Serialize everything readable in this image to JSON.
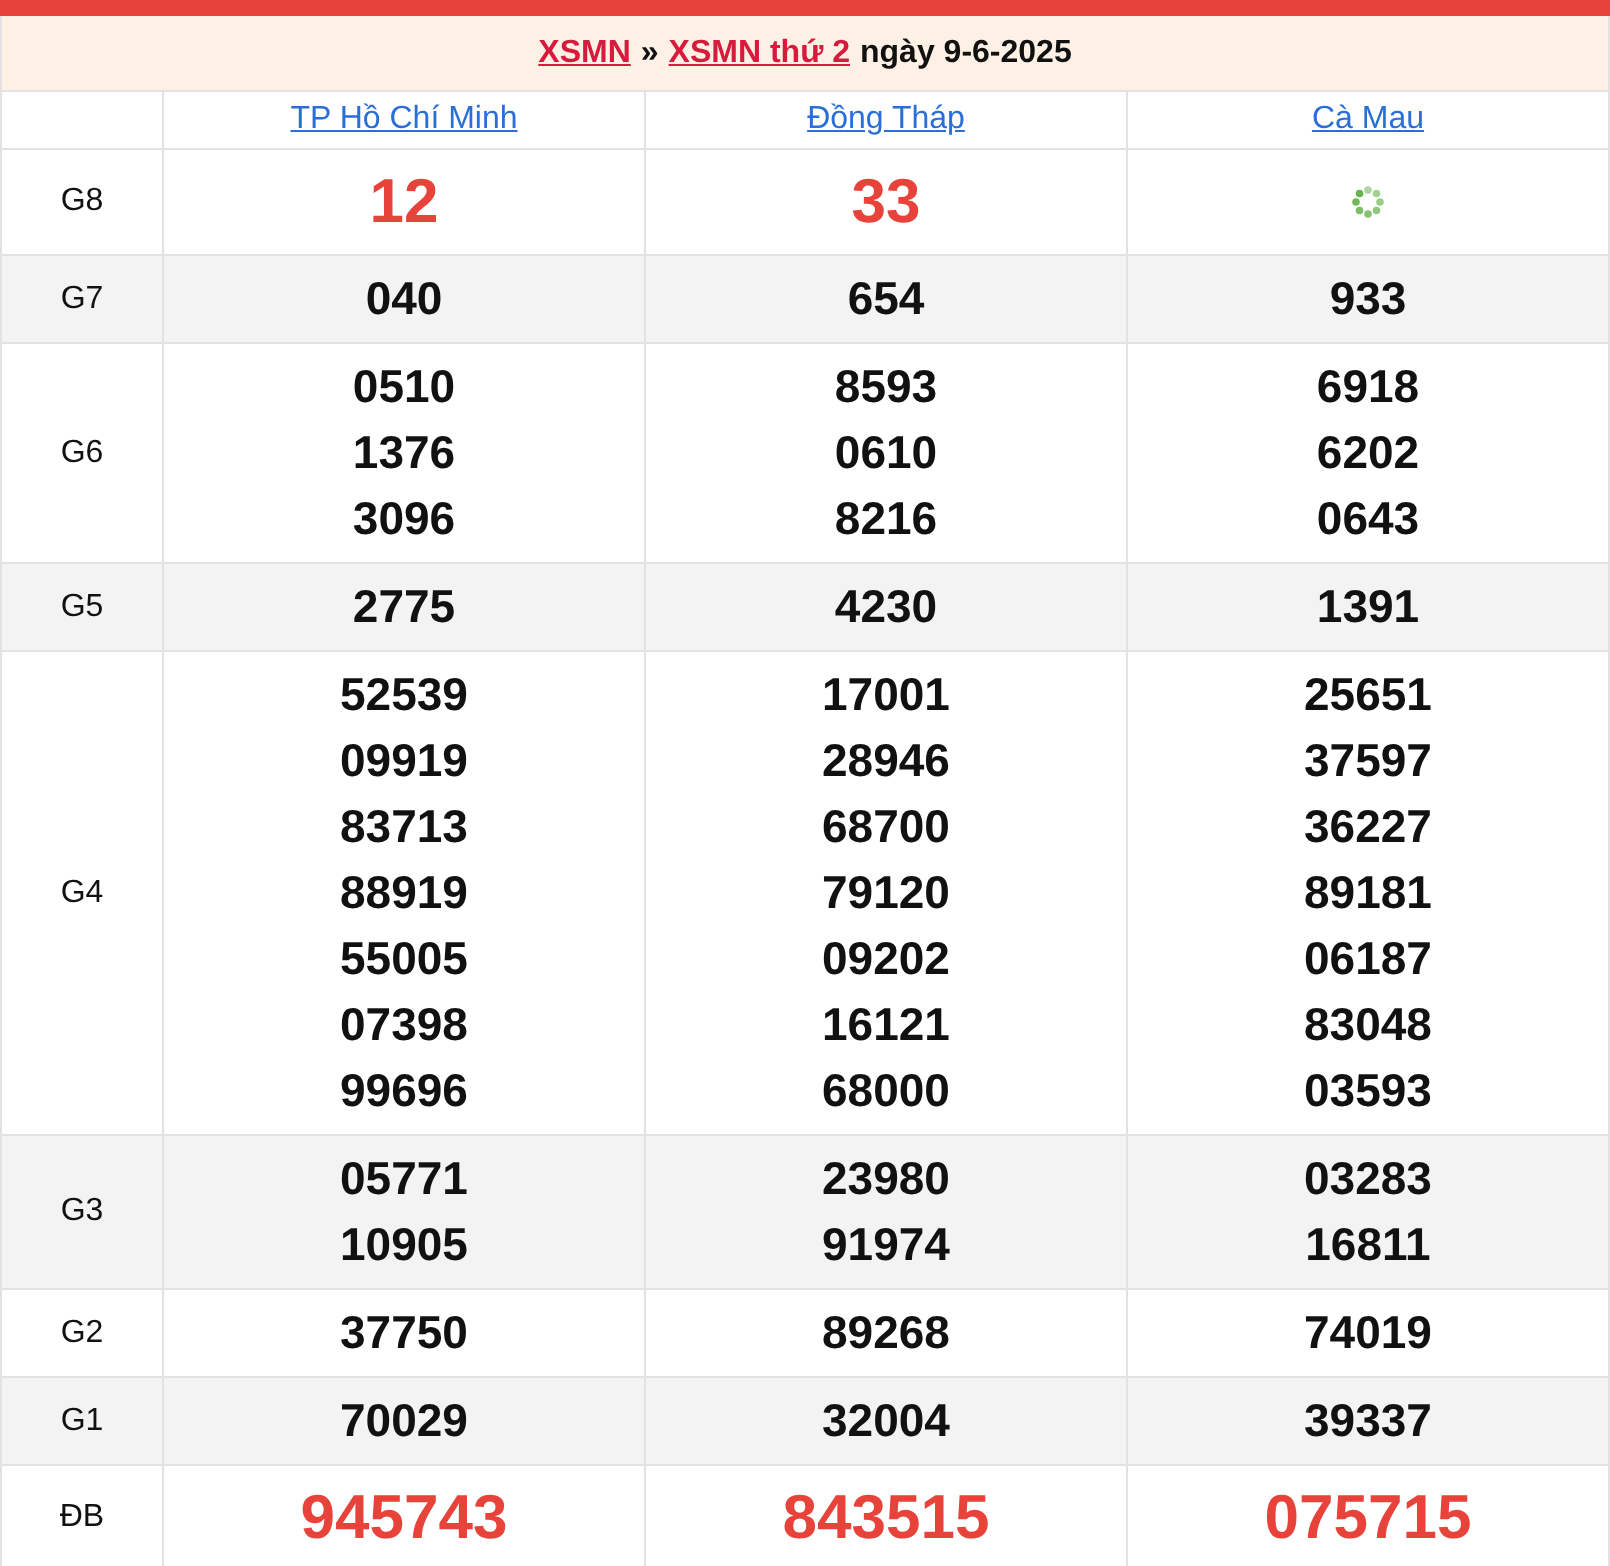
{
  "title": {
    "link1": "XSMN",
    "separator": "»",
    "link2": "XSMN thứ 2",
    "date": "ngày 9-6-2025"
  },
  "provinces": [
    "TP Hồ Chí Minh",
    "Đồng Tháp",
    "Cà Mau"
  ],
  "rows": [
    {
      "label": "G8",
      "kind": "highlight",
      "cells": [
        {
          "kind": "numbers",
          "numbers": [
            "12"
          ]
        },
        {
          "kind": "numbers",
          "numbers": [
            "33"
          ]
        },
        {
          "kind": "loading"
        }
      ]
    },
    {
      "label": "G7",
      "kind": "normal",
      "cells": [
        {
          "kind": "numbers",
          "numbers": [
            "040"
          ]
        },
        {
          "kind": "numbers",
          "numbers": [
            "654"
          ]
        },
        {
          "kind": "numbers",
          "numbers": [
            "933"
          ]
        }
      ]
    },
    {
      "label": "G6",
      "kind": "normal",
      "cells": [
        {
          "kind": "numbers",
          "numbers": [
            "0510",
            "1376",
            "3096"
          ]
        },
        {
          "kind": "numbers",
          "numbers": [
            "8593",
            "0610",
            "8216"
          ]
        },
        {
          "kind": "numbers",
          "numbers": [
            "6918",
            "6202",
            "0643"
          ]
        }
      ]
    },
    {
      "label": "G5",
      "kind": "normal",
      "cells": [
        {
          "kind": "numbers",
          "numbers": [
            "2775"
          ]
        },
        {
          "kind": "numbers",
          "numbers": [
            "4230"
          ]
        },
        {
          "kind": "numbers",
          "numbers": [
            "1391"
          ]
        }
      ]
    },
    {
      "label": "G4",
      "kind": "normal",
      "cells": [
        {
          "kind": "numbers",
          "numbers": [
            "52539",
            "09919",
            "83713",
            "88919",
            "55005",
            "07398",
            "99696"
          ]
        },
        {
          "kind": "numbers",
          "numbers": [
            "17001",
            "28946",
            "68700",
            "79120",
            "09202",
            "16121",
            "68000"
          ]
        },
        {
          "kind": "numbers",
          "numbers": [
            "25651",
            "37597",
            "36227",
            "89181",
            "06187",
            "83048",
            "03593"
          ]
        }
      ]
    },
    {
      "label": "G3",
      "kind": "normal",
      "cells": [
        {
          "kind": "numbers",
          "numbers": [
            "05771",
            "10905"
          ]
        },
        {
          "kind": "numbers",
          "numbers": [
            "23980",
            "91974"
          ]
        },
        {
          "kind": "numbers",
          "numbers": [
            "03283",
            "16811"
          ]
        }
      ]
    },
    {
      "label": "G2",
      "kind": "normal",
      "cells": [
        {
          "kind": "numbers",
          "numbers": [
            "37750"
          ]
        },
        {
          "kind": "numbers",
          "numbers": [
            "89268"
          ]
        },
        {
          "kind": "numbers",
          "numbers": [
            "74019"
          ]
        }
      ]
    },
    {
      "label": "G1",
      "kind": "normal",
      "cells": [
        {
          "kind": "numbers",
          "numbers": [
            "70029"
          ]
        },
        {
          "kind": "numbers",
          "numbers": [
            "32004"
          ]
        },
        {
          "kind": "numbers",
          "numbers": [
            "39337"
          ]
        }
      ]
    },
    {
      "label": "ĐB",
      "kind": "highlight",
      "cells": [
        {
          "kind": "numbers",
          "numbers": [
            "945743"
          ]
        },
        {
          "kind": "numbers",
          "numbers": [
            "843515"
          ]
        },
        {
          "kind": "numbers",
          "numbers": [
            "075715"
          ]
        }
      ]
    }
  ]
}
